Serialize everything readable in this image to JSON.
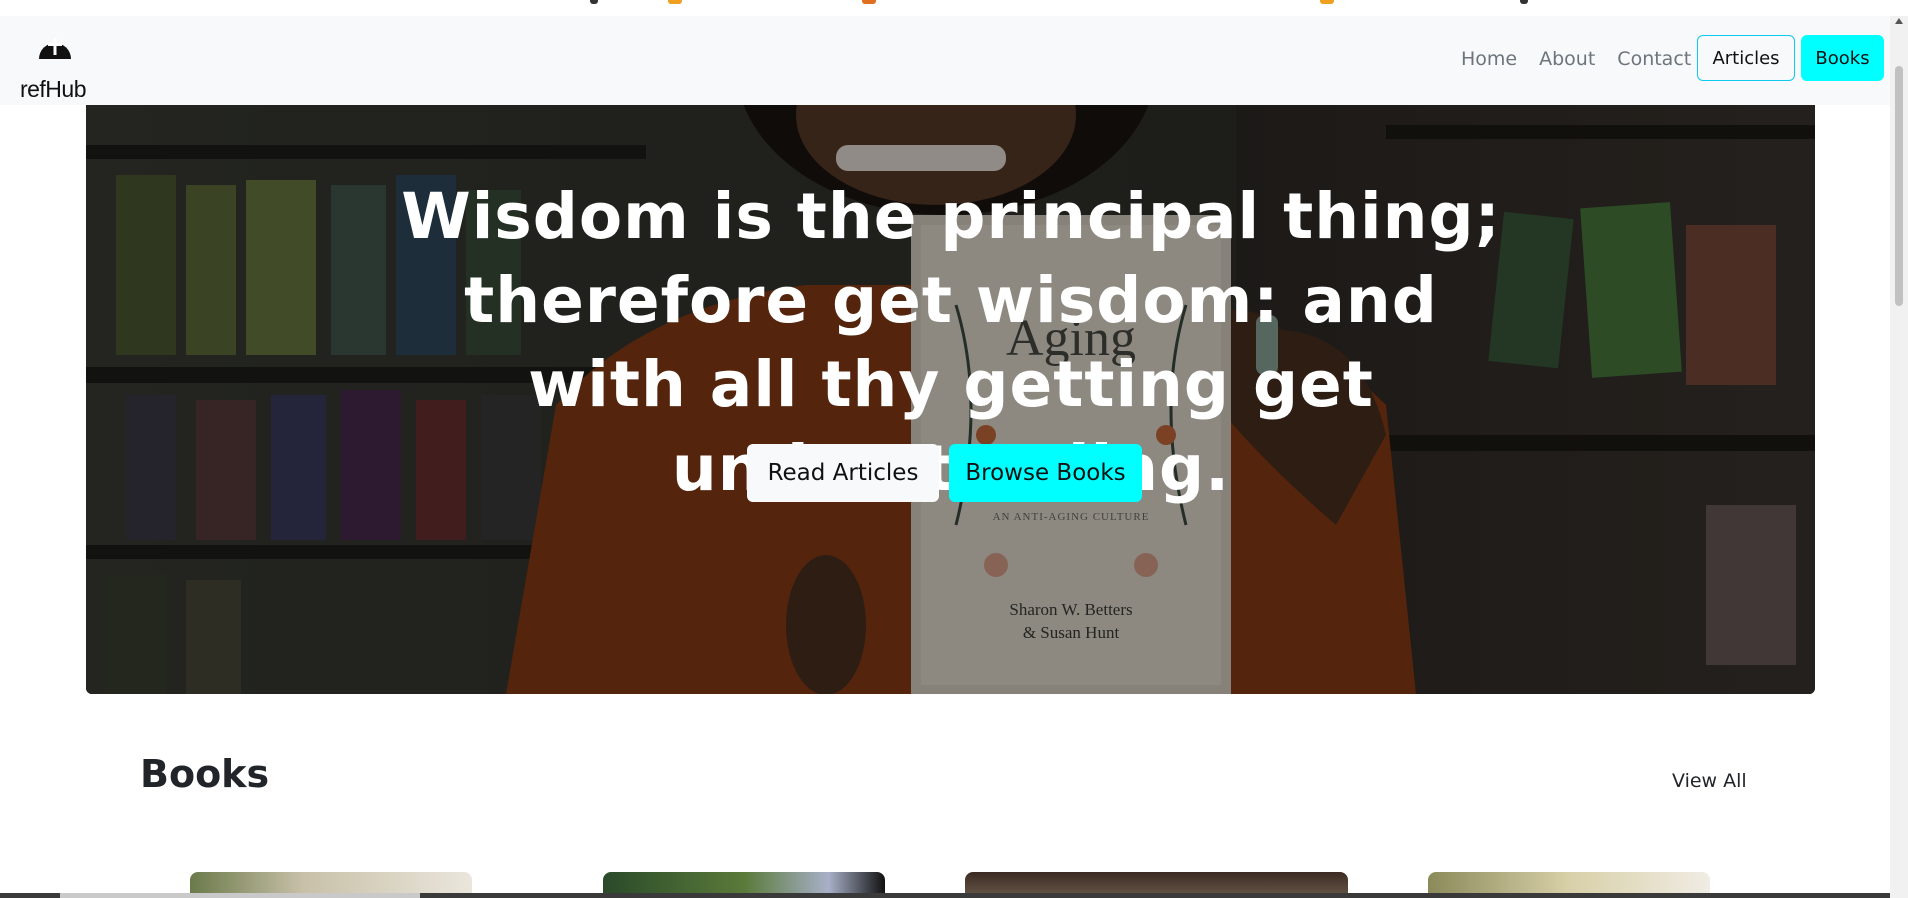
{
  "navbar": {
    "brand": "refHub",
    "links": [
      "Home",
      "About",
      "Contact"
    ],
    "articles_button": "Articles",
    "books_button": "Books"
  },
  "hero": {
    "quote": "Wisdom is the principal thing; therefore get wisdom: and with all thy getting get understanding.",
    "read_button": "Read Articles",
    "browse_button": "Browse Books",
    "book_cover": {
      "title": "Aging",
      "subtitle": "AN ANTI-AGING CULTURE",
      "authors_line1": "Sharon W. Betters",
      "authors_line2": "& Susan Hunt"
    }
  },
  "books_section": {
    "title": "Books",
    "view_all": "View All"
  },
  "colors": {
    "accent": "#00ffff",
    "accent_border": "#0dcaf0",
    "navbar_bg": "#f8f9fa"
  },
  "icons": {
    "brand": "dome-cross-icon"
  }
}
